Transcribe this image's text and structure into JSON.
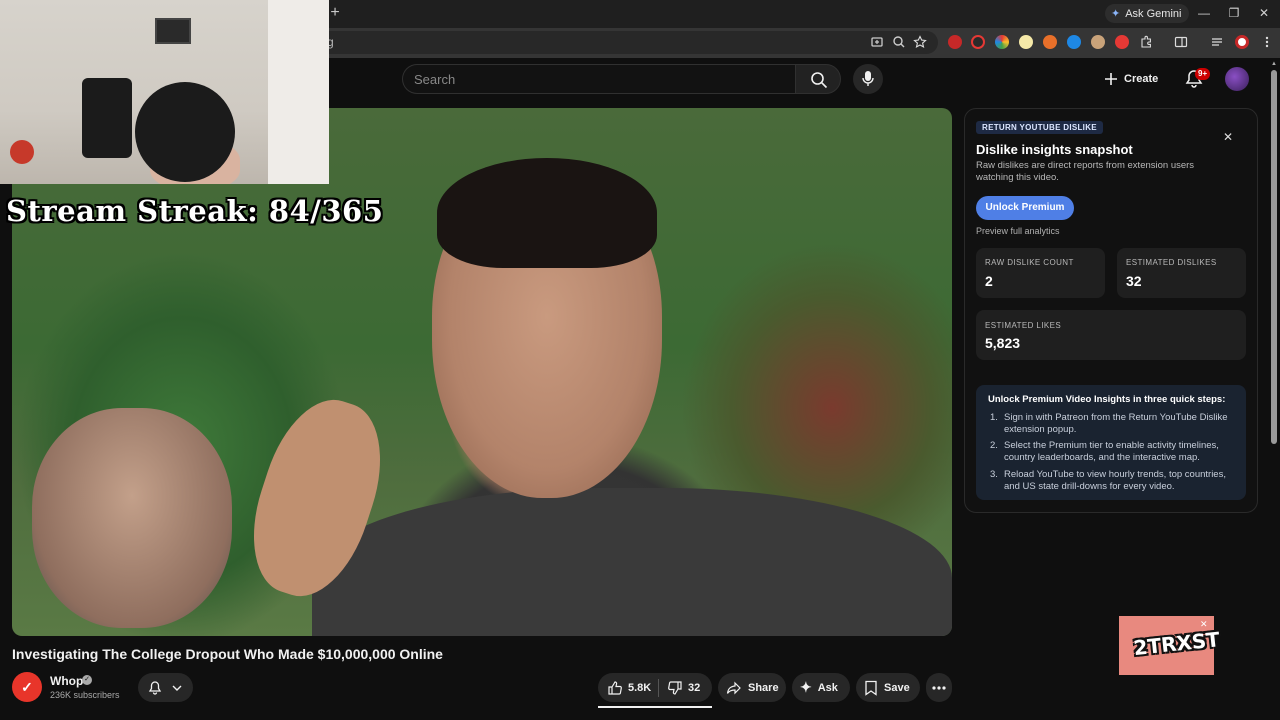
{
  "browser": {
    "new_tab": "+",
    "ask_gemini": "Ask Gemini",
    "omnibox_text": "g",
    "window_controls": [
      "minimize-icon",
      "restore-icon",
      "close-icon"
    ]
  },
  "youtube": {
    "search": {
      "placeholder": "Search"
    },
    "create_label": "Create",
    "notification_count": "9+"
  },
  "overlay": {
    "stream_streak": "Stream Streak: 84/365",
    "logo_text": "2TRXST"
  },
  "video": {
    "title": "Investigating The College Dropout Who Made $10,000,000 Online",
    "channel": {
      "name": "Whop",
      "subscribers": "236K subscribers"
    },
    "actions": {
      "likes": "5.8K",
      "dislikes": "32",
      "share": "Share",
      "ask": "Ask",
      "save": "Save"
    }
  },
  "rtd_panel": {
    "tag": "RETURN YOUTUBE DISLIKE",
    "title": "Dislike insights snapshot",
    "description": "Raw dislikes are direct reports from extension users watching this video.",
    "unlock_button": "Unlock Premium",
    "preview_link": "Preview full analytics",
    "stats": {
      "raw_dislike_label": "RAW DISLIKE COUNT",
      "raw_dislike_value": "2",
      "estimated_dislikes_label": "ESTIMATED DISLIKES",
      "estimated_dislikes_value": "32",
      "estimated_likes_label": "ESTIMATED LIKES",
      "estimated_likes_value": "5,823"
    },
    "steps_title": "Unlock Premium Video Insights in three quick steps:",
    "steps": [
      {
        "num": "1.",
        "text": "Sign in with Patreon from the Return YouTube Dislike extension popup."
      },
      {
        "num": "2.",
        "text": "Select the Premium tier to enable activity timelines, country leaderboards, and the interactive map."
      },
      {
        "num": "3.",
        "text": "Reload YouTube to view hourly trends, top countries, and US state drill-downs for every video."
      }
    ]
  },
  "colors": {
    "accent_blue": "#4f7fe6",
    "yt_red": "#cc0000",
    "channel_red": "#e8352a"
  }
}
